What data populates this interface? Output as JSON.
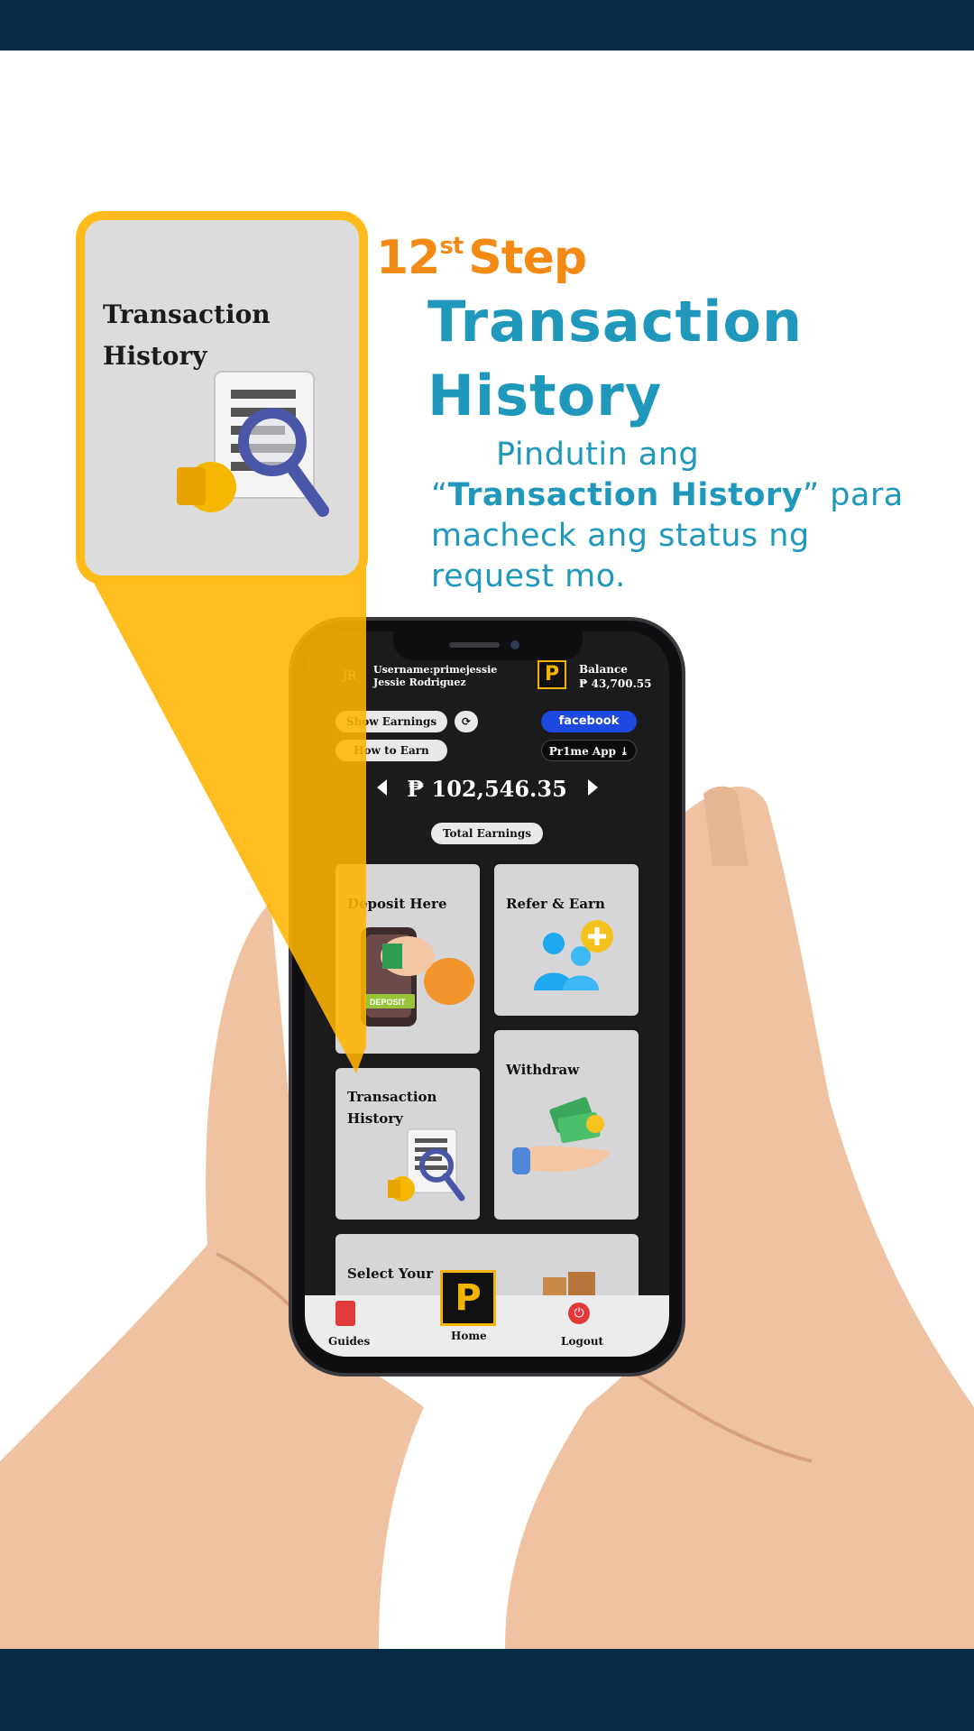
{
  "header": {
    "step_number": "12",
    "step_suffix": "st",
    "step_word": "Step",
    "title_line1": "Transaction",
    "title_line2": "History",
    "desc_part1": "Pindutin ang “",
    "desc_bold": "Transaction History",
    "desc_part2": "” para macheck ang status ng request mo."
  },
  "callout": {
    "label_line1": "Transaction",
    "label_line2": "History"
  },
  "app": {
    "avatar": "JR",
    "username": "Username:primejessie",
    "fullname": "Jessie Rodriguez",
    "logo_letter": "P",
    "balance_label": "Balance",
    "balance_value": "₱ 43,700.55",
    "show_earnings": "Show Earnings",
    "how_to_earn": "How to Earn",
    "facebook": "facebook",
    "prime_app": "Pr1me App",
    "total_amount": "₱ 102,546.35",
    "total_earnings": "Total Earnings",
    "cards": {
      "deposit": "Deposit Here",
      "deposit_tag": "DEPOSIT",
      "refer": "Refer & Earn",
      "transaction_line1": "Transaction",
      "transaction_line2": "History",
      "withdraw": "Withdraw",
      "select": "Select Your"
    },
    "nav": {
      "guides": "Guides",
      "home": "Home",
      "logout": "Logout"
    }
  },
  "colors": {
    "band": "#062b45",
    "step_orange": "#f28a13",
    "title_blue": "#1f98bc",
    "callout_yellow": "#ffbb1c",
    "facebook_blue": "#1e49e0",
    "logo_gold": "#f5b400"
  }
}
